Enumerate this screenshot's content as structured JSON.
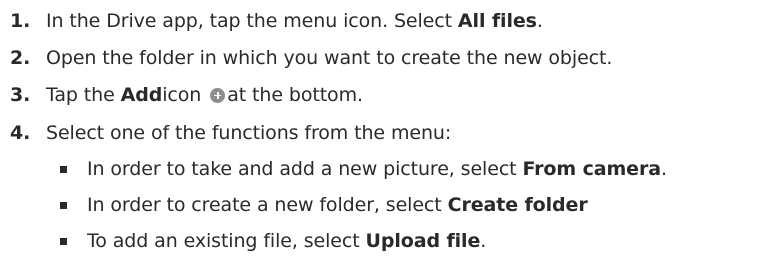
{
  "steps": [
    {
      "number": "1.",
      "before": "In the Drive app, tap the menu icon. Select ",
      "bold": "All files",
      "after": "."
    },
    {
      "number": "2.",
      "text": "Open the folder in which you want to create the new object."
    },
    {
      "number": "3.",
      "before": "Tap the ",
      "bold": "Add",
      "middle": " icon",
      "icon": "add-circle-icon",
      "after": "at the bottom."
    },
    {
      "number": "4.",
      "text": "Select one of the functions from the menu:"
    }
  ],
  "substeps": [
    {
      "before": "In order to take and add a new picture, select ",
      "bold": "From camera",
      "after": "."
    },
    {
      "before": "In order to create a new folder, select ",
      "bold": "Create folder",
      "after": ""
    },
    {
      "before": "To add an existing file, select ",
      "bold": "Upload file",
      "after": "."
    }
  ]
}
